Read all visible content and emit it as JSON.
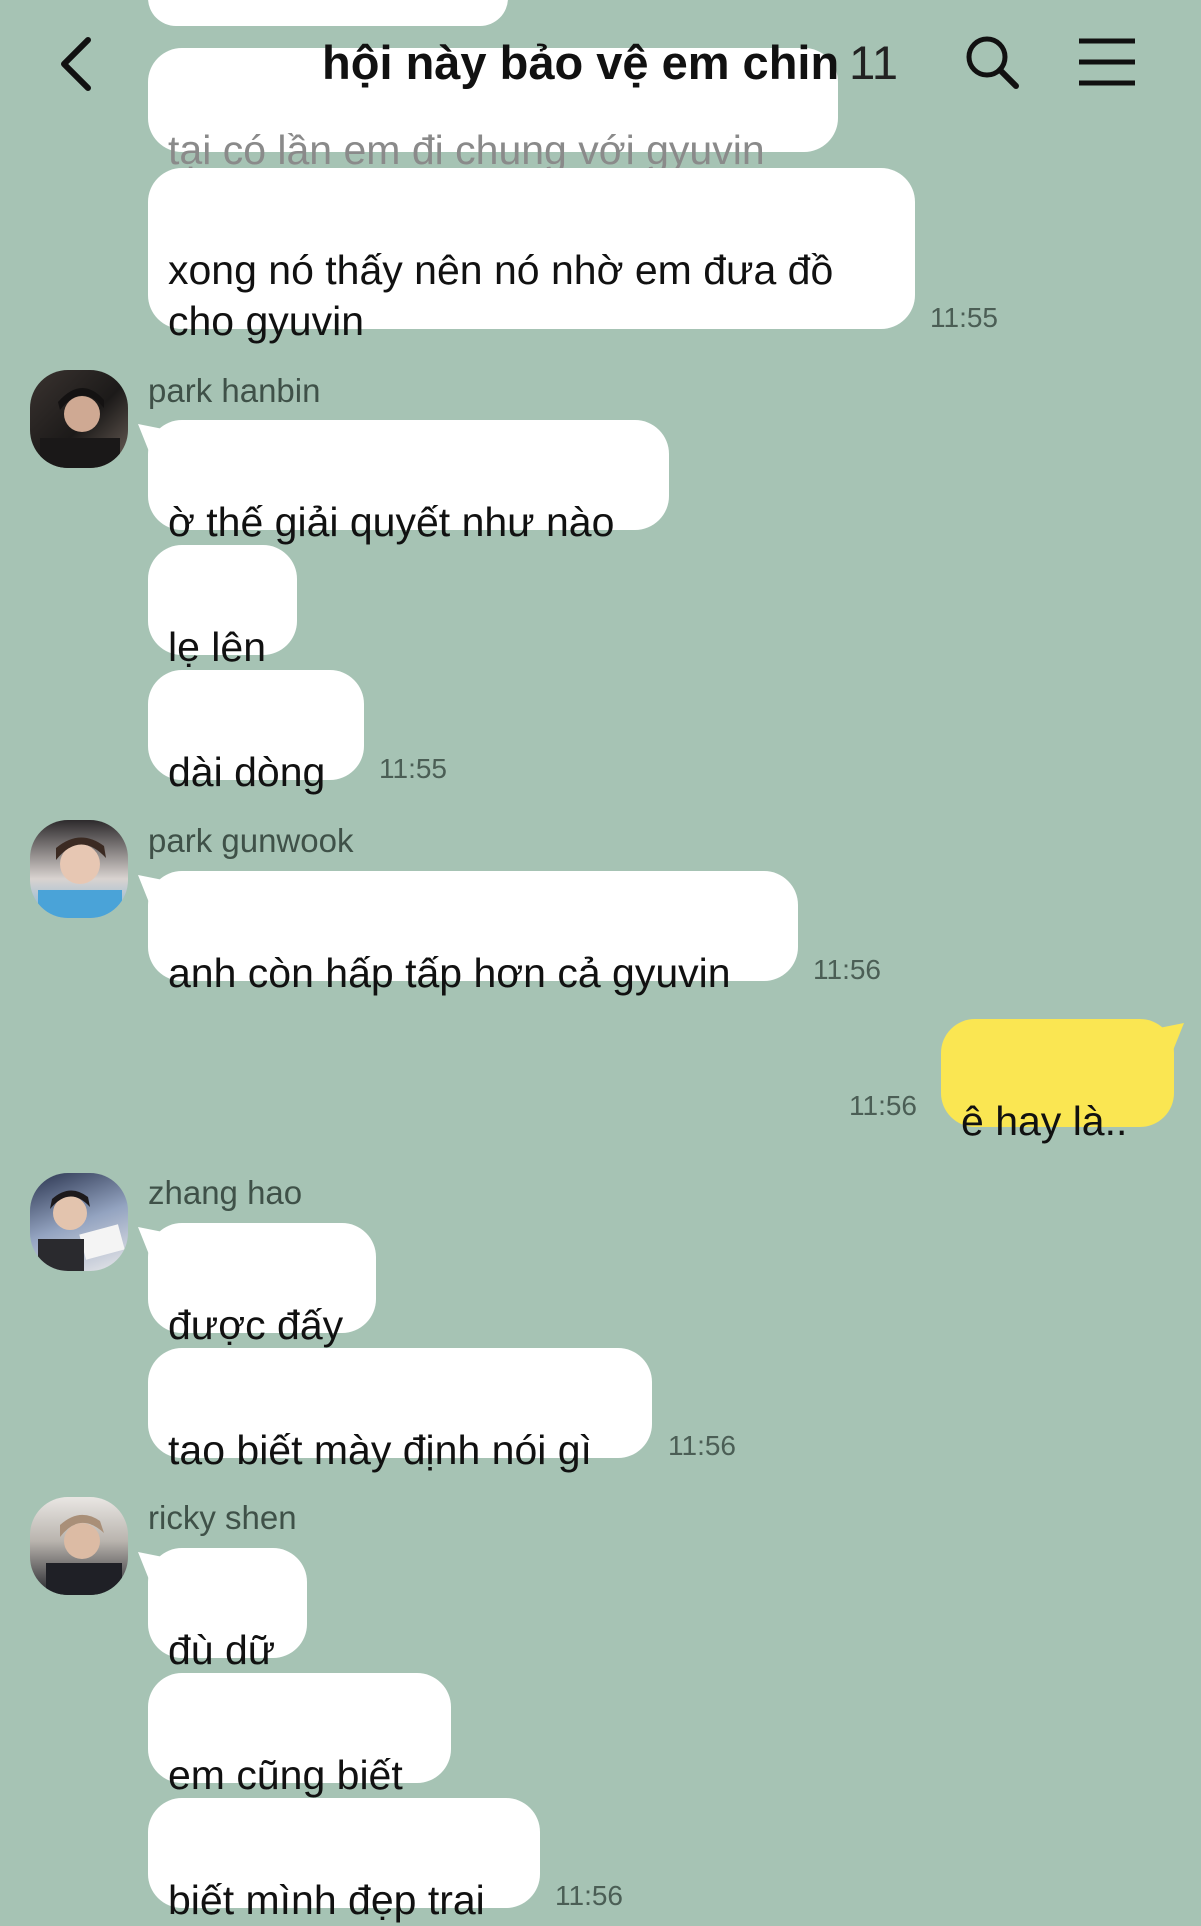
{
  "header": {
    "title": "hội này bảo vệ em chin",
    "member_count": "11"
  },
  "colors": {
    "background": "#a6c3b4",
    "bubble_received": "#ffffff",
    "bubble_sent": "#fae652"
  },
  "messages": {
    "m0": "tại có lần em đi chung với gyuvin",
    "m1": "xong nó thấy nên nó nhờ em đưa đồ\ncho gyuvin",
    "t1": "11:55",
    "s2": "park hanbin",
    "m2": "ờ thế giải quyết như nào",
    "m3": "lẹ lên",
    "m4": "dài dòng",
    "t4": "11:55",
    "s5": "park gunwook",
    "m5": "anh còn hấp tấp hơn cả gyuvin",
    "t5": "11:56",
    "m6": "ê hay là..",
    "t6": "11:56",
    "s7": "zhang hao",
    "m7": "được đấy",
    "m8": "tao biết mày định nói gì",
    "t8": "11:56",
    "s9": "ricky shen",
    "m9": "đù dữ",
    "m10": "em cũng biết",
    "m11": "biết mình đẹp trai",
    "t11": "11:56"
  }
}
